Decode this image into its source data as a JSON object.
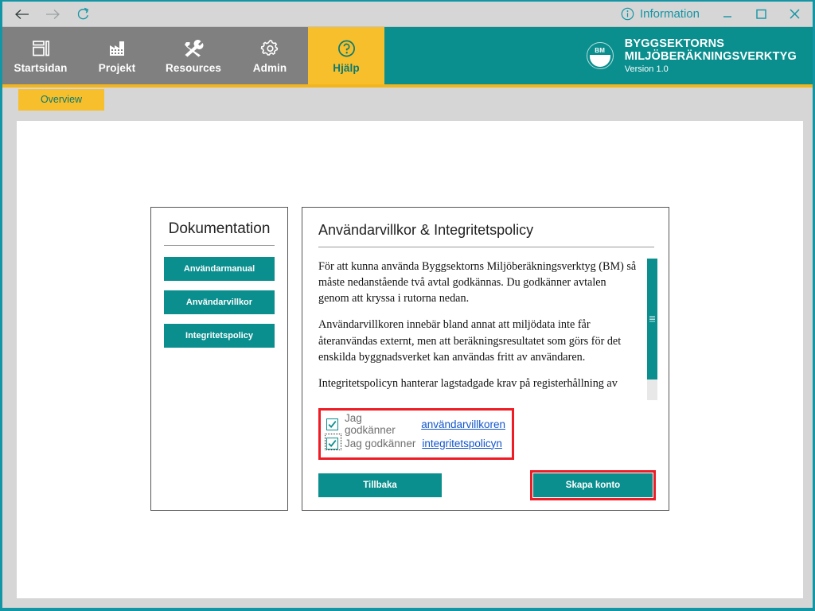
{
  "window": {
    "accent_teal": "#0a8e8e",
    "accent_amber": "#f7bf2c",
    "highlight_red": "#ee1c25",
    "nav_gray": "#808080"
  },
  "titlebar": {
    "back_icon": "arrow-left-icon",
    "forward_icon": "arrow-right-icon",
    "refresh_icon": "refresh-icon",
    "information_label": "Information",
    "information_icon": "info-circle-icon",
    "minimize_icon": "minimize-icon",
    "maximize_icon": "maximize-icon",
    "close_icon": "close-icon"
  },
  "nav": {
    "items": [
      {
        "label": "Startsidan",
        "icon": "dashboard-icon",
        "active": false
      },
      {
        "label": "Projekt",
        "icon": "factory-icon",
        "active": false
      },
      {
        "label": "Resources",
        "icon": "tools-icon",
        "active": false
      },
      {
        "label": "Admin",
        "icon": "gear-icon",
        "active": false
      },
      {
        "label": "Hjälp",
        "icon": "question-circle-icon",
        "active": true
      }
    ]
  },
  "brand": {
    "logo_text": "BM",
    "line1": "BYGGSEKTORNS",
    "line2": "MILJÖBERÄKNINGSVERKTYG",
    "version": "Version 1.0"
  },
  "tabs": {
    "overview_label": "Overview"
  },
  "documentation": {
    "title": "Dokumentation",
    "buttons": [
      "Användarmanual",
      "Användarvillkor",
      "Integritetspolicy"
    ]
  },
  "terms": {
    "title": "Användarvillkor & Integritetspolicy",
    "paragraphs": [
      "För att kunna använda Byggsektorns Miljöberäkningsverktyg (BM) så måste nedanstående två avtal godkännas. Du godkänner avtalen genom att kryssa i rutorna nedan.",
      "Användarvillkoren innebär bland annat att miljödata inte får återanvändas externt, men att beräkningsresultatet som görs för det enskilda byggnadsverket kan användas fritt av användaren.",
      "Integritetspolicyn hanterar lagstadgade krav på registerhållning av"
    ],
    "consents": [
      {
        "prefix": "Jag godkänner",
        "link": "användarvillkoren",
        "checked": true,
        "focused": false
      },
      {
        "prefix": "Jag godkänner",
        "link": "integritetspolicyn",
        "checked": true,
        "focused": true
      }
    ],
    "back_label": "Tillbaka",
    "create_label": "Skapa konto"
  }
}
